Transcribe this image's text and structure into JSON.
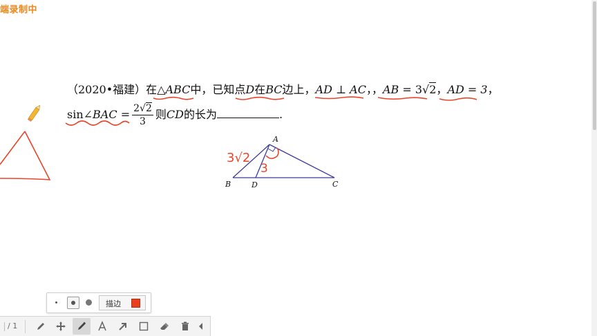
{
  "recording_banner": "端录制中",
  "problem": {
    "source": "（2020•福建）",
    "t1": "在",
    "tri": "△",
    "abc": "ABC",
    "t2": "中，已知点",
    "d": "D",
    "t3": "在",
    "bc": "BC",
    "t4": "边上，",
    "ad_perp": "AD ⊥ AC",
    "t5": "，，",
    "ab_lhs": "AB",
    "ab_eq": " = 3",
    "ab_rad": "2",
    "t6": "，",
    "ad_val": "AD = 3",
    "t7": "，",
    "sin": "sin∠",
    "bac": "BAC",
    "sin_eq": " =",
    "frac_num_coef": "2",
    "frac_num_rad": "2",
    "frac_den": "3",
    "t8": "则",
    "cd": "CD",
    "t9": "的长为",
    "t10": "."
  },
  "figure": {
    "labels": {
      "a": "A",
      "b": "B",
      "c": "C",
      "d": "D"
    },
    "annotations": {
      "ab_len": "3√2",
      "ad_len": "3"
    }
  },
  "brush_panel": {
    "outline_label": "描边",
    "outline_color": "#e8401f"
  },
  "toolbar": {
    "page_counter": "/ 1",
    "tools": [
      "pen-icon",
      "move-icon",
      "brush-icon",
      "text-icon",
      "arrow-icon",
      "rectangle-icon",
      "eraser-icon",
      "trash-icon",
      "collapse-icon"
    ],
    "active_tool": "brush-icon"
  },
  "colors": {
    "ink_red": "#e8452a",
    "figure_blue": "#3a3a9a",
    "banner_orange": "#f0861a"
  }
}
